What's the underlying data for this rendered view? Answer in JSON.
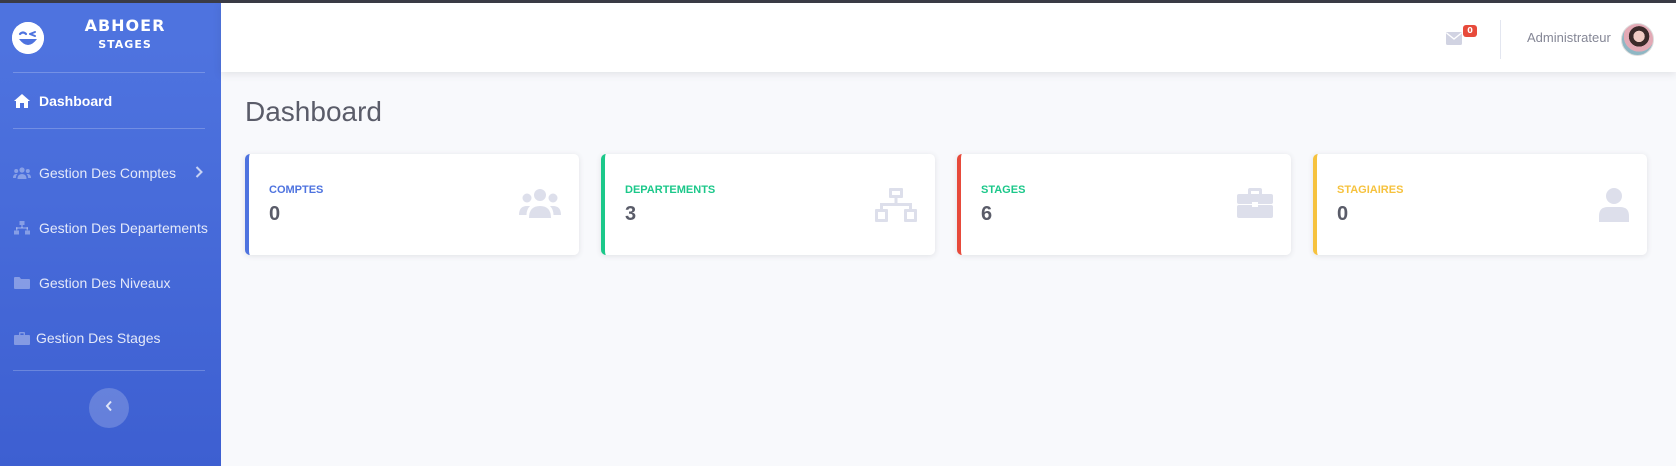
{
  "brand": {
    "title": "ABHOER",
    "subtitle": "STAGES",
    "logo_icon": "laughing-face-icon"
  },
  "sidebar": {
    "items": [
      {
        "label": "Dashboard",
        "icon": "home-icon",
        "active": true
      },
      {
        "label": "Gestion Des Comptes",
        "icon": "users-icon",
        "has_submenu": true
      },
      {
        "label": "Gestion Des Departements",
        "icon": "sitemap-icon"
      },
      {
        "label": "Gestion Des Niveaux",
        "icon": "folder-icon"
      },
      {
        "label": "Gestion Des Stages",
        "icon": "briefcase-icon"
      }
    ],
    "toggle_icon": "chevron-left-icon"
  },
  "topbar": {
    "messages_icon": "envelope-icon",
    "messages_count": "0",
    "user_name": "Administrateur"
  },
  "page": {
    "title": "Dashboard"
  },
  "cards": [
    {
      "title": "COMPTES",
      "value": "0",
      "icon": "users-icon",
      "color": "#4e73df"
    },
    {
      "title": "DEPARTEMENTS",
      "value": "3",
      "icon": "sitemap-icon",
      "color": "#1cc88a"
    },
    {
      "title": "STAGES",
      "value": "6",
      "icon": "briefcase-icon",
      "color": "#e74a3b"
    },
    {
      "title": "STAGIAIRES",
      "value": "0",
      "icon": "user-icon",
      "color": "#f6c23e"
    }
  ]
}
